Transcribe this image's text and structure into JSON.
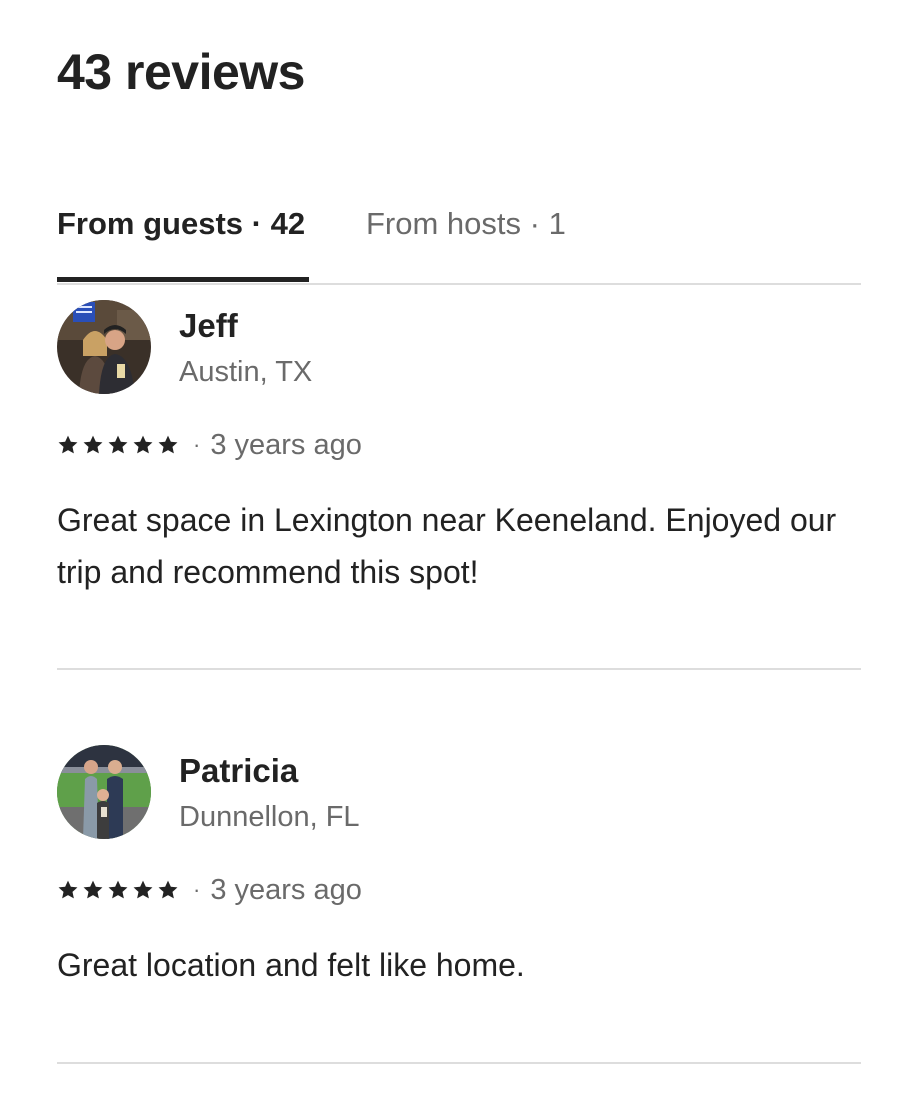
{
  "page": {
    "title": "43 reviews"
  },
  "tabs": [
    {
      "label": "From guests · 42",
      "active": true
    },
    {
      "label": "From hosts · 1",
      "active": false
    }
  ],
  "reviews": [
    {
      "name": "Jeff",
      "location": "Austin, TX",
      "rating": 5,
      "separator": "·",
      "date": "3 years ago",
      "text": "Great space in Lexington near Keeneland. Enjoyed our trip and recommend this spot!",
      "avatar_icon": "avatar-photo"
    },
    {
      "name": "Patricia",
      "location": "Dunnellon, FL",
      "rating": 5,
      "separator": "·",
      "date": "3 years ago",
      "text": "Great location and felt like home.",
      "avatar_icon": "avatar-photo"
    }
  ],
  "colors": {
    "text_primary": "#222222",
    "text_secondary": "#6a6a6a",
    "divider": "#dddddd",
    "star": "#222222"
  },
  "icons": {
    "star": "star-icon"
  }
}
